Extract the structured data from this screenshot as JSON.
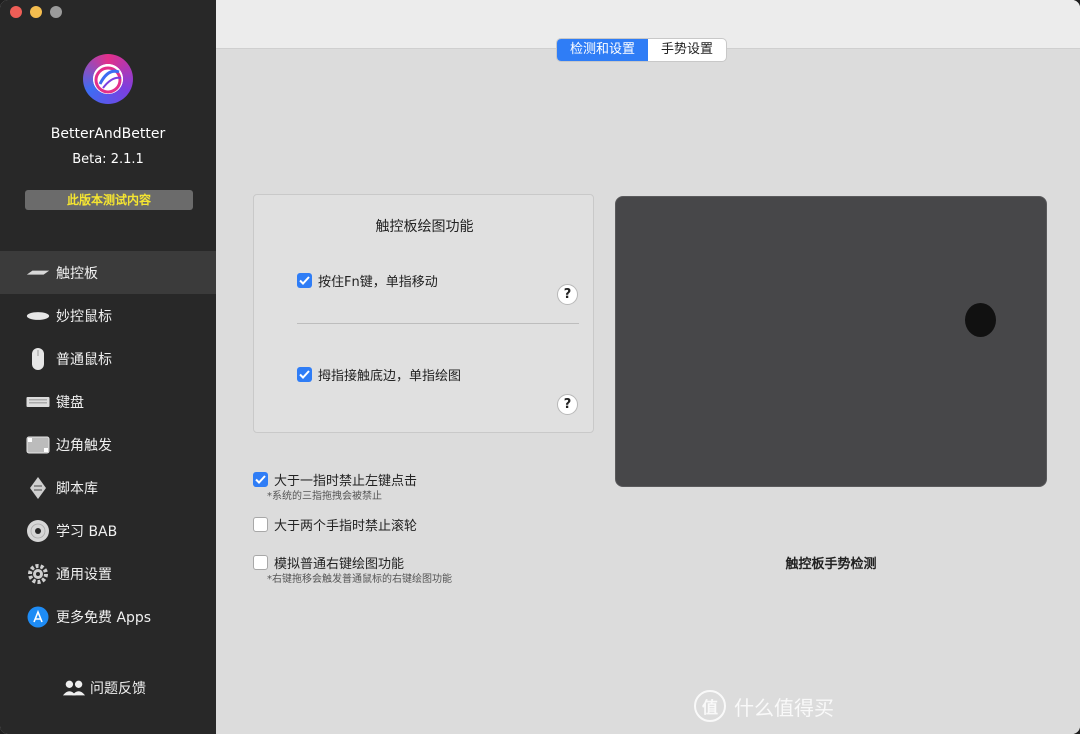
{
  "app": {
    "name": "BetterAndBetter",
    "version": "Beta:  2.1.1",
    "beta_badge": "此版本测试内容"
  },
  "sidebar": {
    "items": [
      {
        "label": "触控板",
        "icon": "trackpad-icon",
        "active": true
      },
      {
        "label": "妙控鼠标",
        "icon": "magic-mouse-icon",
        "active": false
      },
      {
        "label": "普通鼠标",
        "icon": "mouse-icon",
        "active": false
      },
      {
        "label": "键盘",
        "icon": "keyboard-icon",
        "active": false
      },
      {
        "label": "边角触发",
        "icon": "hot-corner-icon",
        "active": false
      },
      {
        "label": "脚本库",
        "icon": "script-icon",
        "active": false
      },
      {
        "label": "学习 BAB",
        "icon": "disc-icon",
        "active": false
      },
      {
        "label": "通用设置",
        "icon": "gear-icon",
        "active": false
      },
      {
        "label": "更多免费 Apps",
        "icon": "app-store-icon",
        "active": false
      }
    ],
    "feedback_label": "问题反馈"
  },
  "tabs": [
    {
      "label": "检测和设置",
      "active": true
    },
    {
      "label": "手势设置",
      "active": false
    }
  ],
  "panel": {
    "title": "触控板绘图功能",
    "options": [
      {
        "label": "按住Fn键，单指移动",
        "checked": true
      },
      {
        "label": "拇指接触底边，单指绘图",
        "checked": true
      }
    ],
    "help_label": "?"
  },
  "options": [
    {
      "label": "大于一指时禁止左键点击",
      "note": "*系统的三指拖拽会被禁止",
      "checked": true
    },
    {
      "label": "大于两个手指时禁止滚轮",
      "note": "",
      "checked": false
    },
    {
      "label": "模拟普通右键绘图功能",
      "note": "*右键拖移会触发普通鼠标的右键绘图功能",
      "checked": false
    }
  ],
  "trackpad": {
    "caption": "触控板手势检测"
  },
  "watermark": {
    "symbol": "值",
    "text": "什么值得买"
  },
  "colors": {
    "accent": "#2f7df6",
    "sidebar_bg": "#282828",
    "badge_text": "#f5e531",
    "trackpad": "#474749"
  }
}
